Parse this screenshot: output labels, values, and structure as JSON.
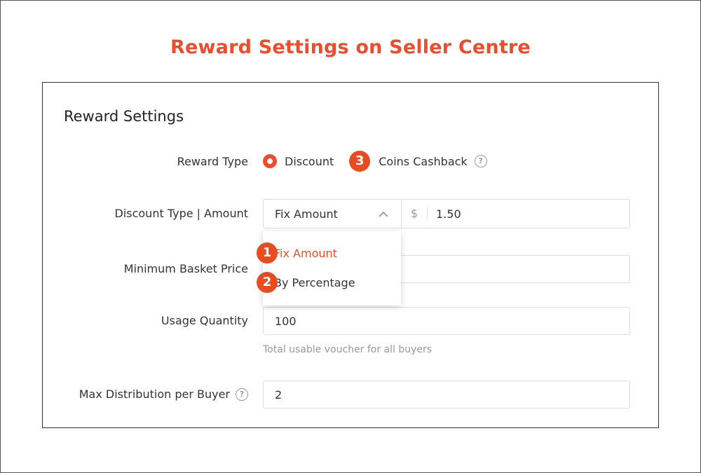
{
  "page": {
    "title": "Reward Settings on Seller Centre"
  },
  "card": {
    "title": "Reward Settings"
  },
  "reward_type": {
    "label": "Reward Type",
    "options": [
      {
        "label": "Discount",
        "selected": true
      },
      {
        "label": "Coins Cashback",
        "selected": false
      }
    ],
    "badge": "3"
  },
  "discount_type": {
    "label": "Discount Type | Amount",
    "selected": "Fix Amount",
    "currency": "$",
    "amount": "1.50",
    "dropdown": [
      {
        "label": "Fix Amount",
        "badge": "1",
        "active": true
      },
      {
        "label": "By Percentage",
        "badge": "2",
        "active": false
      }
    ]
  },
  "min_basket": {
    "label": "Minimum Basket Price",
    "value": ""
  },
  "usage_quantity": {
    "label": "Usage Quantity",
    "value": "100",
    "hint": "Total usable voucher for all buyers"
  },
  "max_distribution": {
    "label": "Max Distribution per Buyer",
    "value": "2"
  },
  "colors": {
    "accent": "#ee4d2d",
    "border": "#dddddd",
    "muted": "#999999"
  },
  "icons": {
    "help": "question-circle-icon",
    "chevron": "chevron-up-icon"
  }
}
